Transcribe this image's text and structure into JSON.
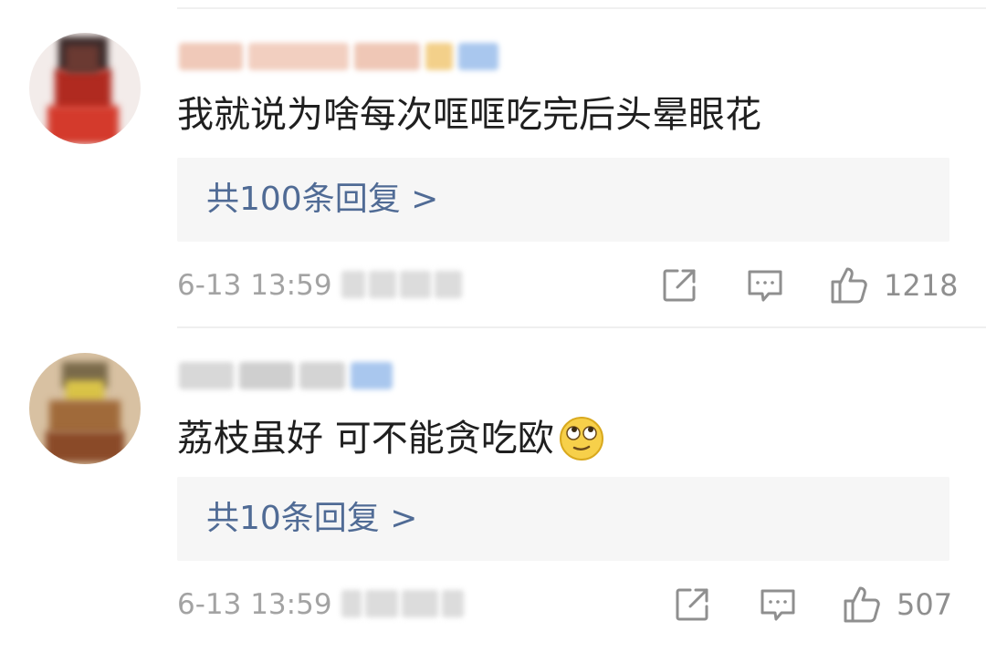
{
  "comments": [
    {
      "text": "我就说为啥每次哐哐吃完后头晕眼花",
      "replies_label": "共100条回复 >",
      "timestamp": "6-13 13:59",
      "like_count": "1218"
    },
    {
      "text": "荔枝虽好 可不能贪吃欧",
      "emoji": "rolling-eyes-emoji",
      "replies_label": "共10条回复 >",
      "timestamp": "6-13 13:59",
      "like_count": "507"
    }
  ],
  "icons": {
    "share": "share-icon",
    "comment": "comment-icon",
    "like": "thumbs-up-icon"
  },
  "colors": {
    "link": "#506b95",
    "muted": "#a3a3a3",
    "reply_background": "#f6f6f6"
  }
}
